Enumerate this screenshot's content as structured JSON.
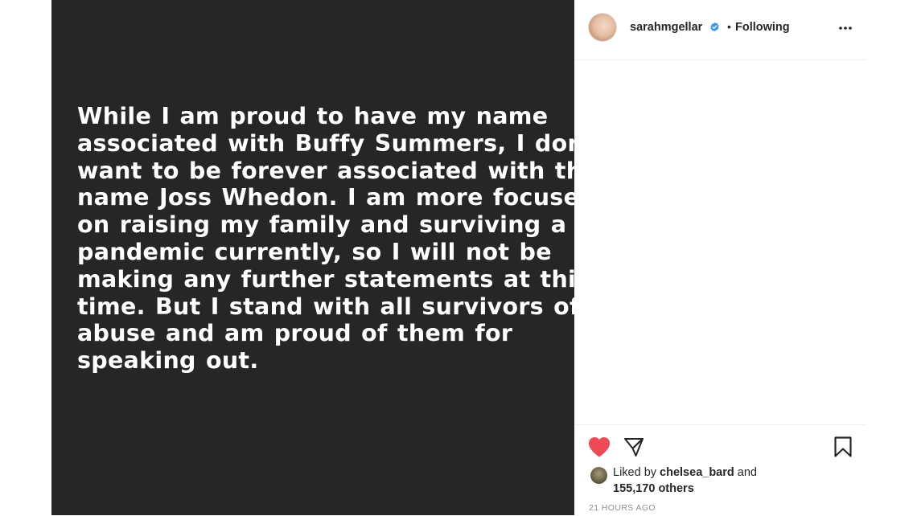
{
  "post": {
    "statement_lines": [
      "While I am proud to have my name",
      "associated with Buffy Summers, I don’t",
      "want to be forever associated with the",
      "name Joss Whedon. I am more focused",
      "on raising my family and surviving a",
      "pandemic currently, so I will not be",
      "making any further statements at this",
      "time. But I stand with all survivors of",
      "abuse and am proud of them for",
      "speaking out."
    ],
    "background_color": "#262626",
    "text_color": "#ffffff"
  },
  "header": {
    "username": "sarahmgellar",
    "separator": "•",
    "follow_status": "Following",
    "icons": {
      "verified": "verified-badge-icon",
      "more": "more-options-icon"
    },
    "verified_color": "#3897f0"
  },
  "actions": {
    "icons": {
      "like": "heart-icon",
      "share": "paper-plane-icon",
      "save": "bookmark-icon"
    },
    "like_color": "#ed4956"
  },
  "likes": {
    "prefix": "Liked by",
    "user": "chelsea_bard",
    "conjunction": "and",
    "count_text": "155,170 others"
  },
  "timestamp": "21 HOURS AGO"
}
